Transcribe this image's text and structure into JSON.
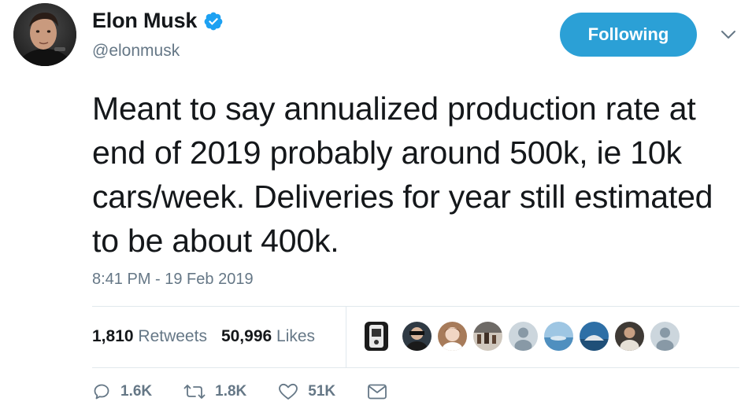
{
  "user": {
    "display_name": "Elon Musk",
    "handle": "@elonmusk",
    "verified": true,
    "avatar_icon": "profile-photo"
  },
  "follow_button": {
    "label": "Following"
  },
  "menu_icon": "chevron-down-icon",
  "tweet": {
    "text": "Meant to say annualized production rate at end of 2019 probably around 500k, ie 10k cars/week. Deliveries for year still estimated to be about 400k.",
    "timestamp": "8:41 PM - 19 Feb 2019"
  },
  "stats": {
    "retweets_count": "1,810",
    "retweets_label": "Retweets",
    "likes_count": "50,996",
    "likes_label": "Likes"
  },
  "likers": [
    {
      "icon": "liker-avatar-1"
    },
    {
      "icon": "liker-avatar-2"
    },
    {
      "icon": "liker-avatar-3"
    },
    {
      "icon": "liker-avatar-4"
    },
    {
      "icon": "liker-avatar-default"
    },
    {
      "icon": "liker-avatar-6"
    },
    {
      "icon": "liker-avatar-7"
    },
    {
      "icon": "liker-avatar-8"
    },
    {
      "icon": "liker-avatar-default"
    }
  ],
  "actions": {
    "reply_count": "1.6K",
    "retweet_count": "1.8K",
    "like_count": "51K"
  },
  "colors": {
    "accent": "#1da1f2",
    "follow_bg": "#2ba0d6",
    "muted": "#657786",
    "text": "#14171a",
    "divider": "#e1e8ed"
  }
}
